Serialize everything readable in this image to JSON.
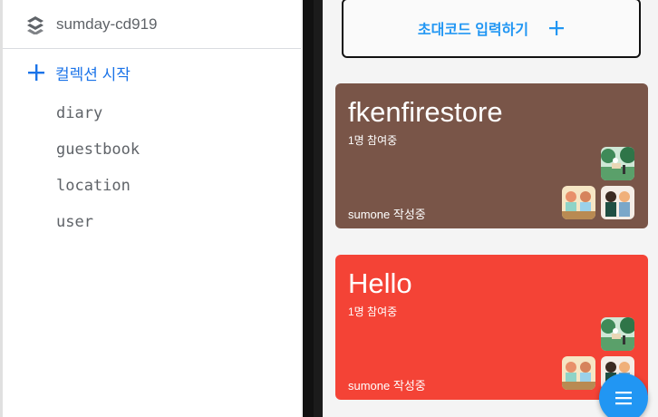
{
  "firestore": {
    "project_name": "sumday-cd919",
    "start_collection_label": "컬렉션 시작",
    "collections": [
      {
        "label": "diary"
      },
      {
        "label": "guestbook"
      },
      {
        "label": "location"
      },
      {
        "label": "user"
      }
    ]
  },
  "app": {
    "invite_label": "초대코드 입력하기",
    "cards": [
      {
        "title": "fkenfirestore",
        "participants": "1명 참여중",
        "author": "sumone 작성중",
        "color": "#795548"
      },
      {
        "title": "Hello",
        "participants": "1명 참여중",
        "author": "sumone 작성중",
        "color": "#f44336"
      }
    ],
    "fab_icon": "menu-icon"
  },
  "colors": {
    "accent_blue": "#1a73e8",
    "app_blue": "#2196f3",
    "text_gray": "#5f6368"
  }
}
